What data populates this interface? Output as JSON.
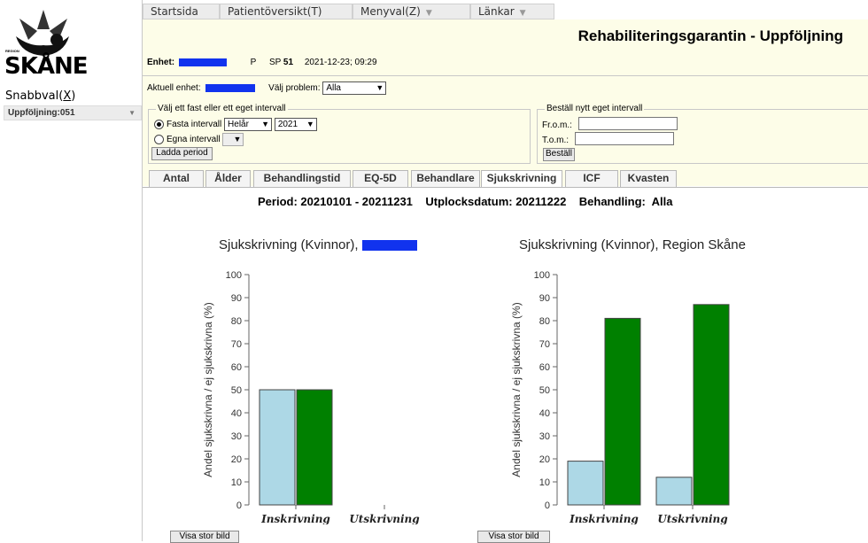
{
  "sidebar": {
    "logo_text": "SKÅNE",
    "logo_region": "REGION",
    "snabbval_label": "Snabbval(",
    "snabbval_key": "X",
    "snabbval_close": ")",
    "quick_select_value": "Uppföljning:051"
  },
  "menu": {
    "tabs": [
      {
        "label": "Startsida",
        "dropdown": false
      },
      {
        "label": "Patientöversikt(T)",
        "dropdown": false
      },
      {
        "label": "Menyval(Z)",
        "dropdown": true
      },
      {
        "label": "Länkar",
        "dropdown": true
      }
    ]
  },
  "header": {
    "title": "Rehabiliteringsgarantin - Uppföljning",
    "enhet_label": "Enhet:",
    "p_label": "P",
    "sp_label": "SP",
    "sp_value": "51",
    "timestamp": "2021-12-23; 09:29",
    "aktuell_label": "Aktuell enhet:",
    "problem_label": "Välj problem:",
    "problem_value": "Alla"
  },
  "interval": {
    "legend": "Välj ett fast eller ett eget intervall",
    "fasta_label": "Fasta intervall",
    "fasta_selected": true,
    "period_value": "Helår",
    "year_value": "2021",
    "egna_label": "Egna intervall",
    "load_button": "Ladda period"
  },
  "custom_interval": {
    "legend": "Beställ nytt eget intervall",
    "from_label": "Fr.o.m.:",
    "to_label": "T.o.m.:",
    "order_button": "Beställ"
  },
  "tabs": [
    {
      "label": "Antal",
      "active": false
    },
    {
      "label": "Ålder",
      "active": false
    },
    {
      "label": "Behandlingstid",
      "active": false
    },
    {
      "label": "EQ-5D",
      "active": false
    },
    {
      "label": "Behandlare",
      "active": false
    },
    {
      "label": "Sjukskrivning",
      "active": true
    },
    {
      "label": "ICF",
      "active": false
    },
    {
      "label": "Kvasten",
      "active": false
    }
  ],
  "period_line": "Period: 20210101 - 20211231    Utplocksdatum: 20211222    Behandling:  Alla",
  "colors": {
    "light_bar": "#add8e6",
    "dark_bar": "#008000",
    "redaction": "#1133ee",
    "header_bg": "#fdfde8"
  },
  "chart_data": [
    {
      "type": "bar",
      "title": "Sjukskrivning (Kvinnor),",
      "ylabel": "Andel sjukskrivna / ej sjukskrivna (%)",
      "ylim": [
        0,
        100
      ],
      "yticks": [
        0,
        10,
        20,
        30,
        40,
        50,
        60,
        70,
        80,
        90,
        100
      ],
      "categories": [
        "Inskrivning",
        "Utskrivning"
      ],
      "series": [
        {
          "values": [
            50,
            0
          ],
          "color": "#add8e6"
        },
        {
          "values": [
            50,
            0
          ],
          "color": "#008000"
        }
      ],
      "button": "Visa stor bild"
    },
    {
      "type": "bar",
      "title": "Sjukskrivning (Kvinnor), Region Skåne",
      "ylabel": "Andel sjukskrivna / ej sjukskrivna (%)",
      "ylim": [
        0,
        100
      ],
      "yticks": [
        0,
        10,
        20,
        30,
        40,
        50,
        60,
        70,
        80,
        90,
        100
      ],
      "categories": [
        "Inskrivning",
        "Utskrivning"
      ],
      "series": [
        {
          "values": [
            19,
            12
          ],
          "color": "#add8e6"
        },
        {
          "values": [
            81,
            87
          ],
          "color": "#008000"
        }
      ],
      "button": "Visa stor bild"
    }
  ]
}
